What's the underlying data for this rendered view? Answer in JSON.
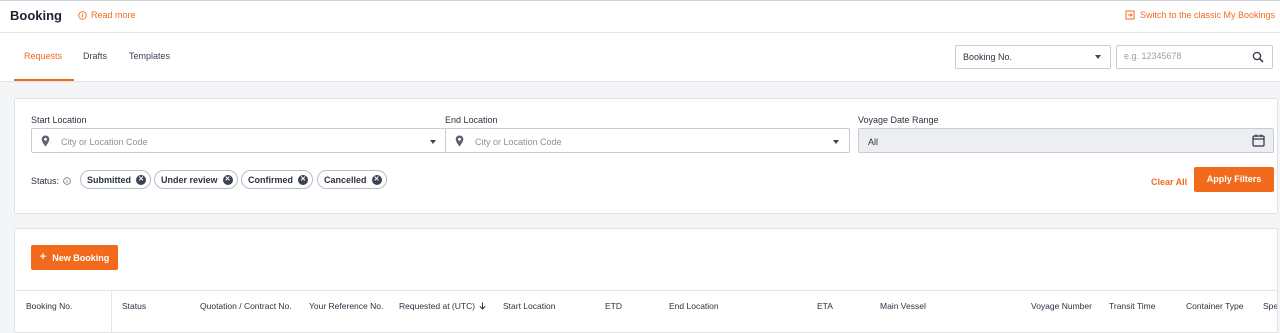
{
  "header": {
    "title": "Booking",
    "read_more": "Read more",
    "switch_classic": "Switch to the classic My Bookings"
  },
  "tabs": [
    {
      "label": "Requests",
      "active": true
    },
    {
      "label": "Drafts",
      "active": false
    },
    {
      "label": "Templates",
      "active": false
    }
  ],
  "search": {
    "type_selected": "Booking No.",
    "placeholder": "e.g. 12345678"
  },
  "filters": {
    "start_location": {
      "label": "Start Location",
      "placeholder": "City or Location Code"
    },
    "end_location": {
      "label": "End Location",
      "placeholder": "City or Location Code"
    },
    "voyage_date_range": {
      "label": "Voyage Date Range",
      "value": "All"
    },
    "status_label": "Status:",
    "status_chips": [
      "Submitted",
      "Under review",
      "Confirmed",
      "Cancelled"
    ],
    "clear_all": "Clear All",
    "apply": "Apply Filters"
  },
  "list": {
    "new_booking": "New Booking",
    "columns": [
      "Booking No.",
      "Status",
      "Quotation / Contract No.",
      "Your Reference No.",
      "Requested at (UTC)",
      "Start Location",
      "ETD",
      "End Location",
      "ETA",
      "Main Vessel",
      "Voyage Number",
      "Transit Time",
      "Container Type",
      "Spe"
    ]
  },
  "colors": {
    "accent": "#f26b1d",
    "text": "#1f2633",
    "border": "#c8ccd3",
    "page_bg": "#f4f5f7"
  }
}
